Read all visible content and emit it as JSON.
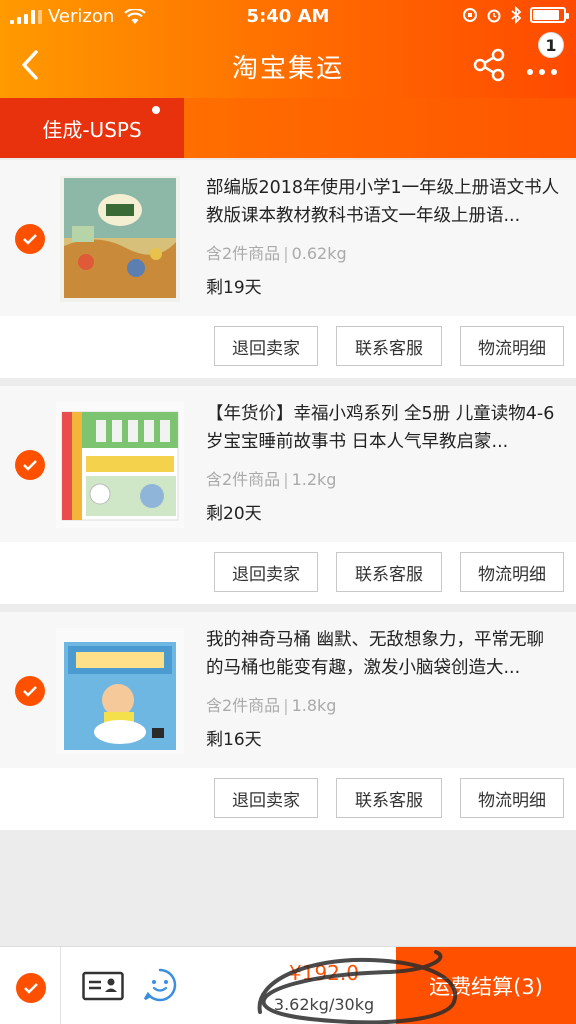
{
  "status_bar": {
    "carrier": "Verizon",
    "time": "5:40 AM",
    "battery_level": 0.85
  },
  "nav": {
    "title": "淘宝集运",
    "more_badge": "1"
  },
  "tabs": [
    {
      "label": "佳成-USPS",
      "active": true,
      "has_dot": true
    }
  ],
  "packages": [
    {
      "title": "部编版2018年使用小学1一年级上册语文书人教版课本教材教科书语文一年级上册语...",
      "item_count": "含2件商品",
      "weight": "0.62kg",
      "days_left": "剩19天",
      "selected": true
    },
    {
      "title": "【年货价】幸福小鸡系列 全5册 儿童读物4-6岁宝宝睡前故事书 日本人气早教启蒙...",
      "item_count": "含2件商品",
      "weight": "1.2kg",
      "days_left": "剩20天",
      "selected": true
    },
    {
      "title": "我的神奇马桶 幽默、无敌想象力，平常无聊的马桶也能变有趣，激发小脑袋创造大...",
      "item_count": "含2件商品",
      "weight": "1.8kg",
      "days_left": "剩16天",
      "selected": true
    }
  ],
  "actions": {
    "return_seller": "退回卖家",
    "contact_service": "联系客服",
    "logistics_detail": "物流明细"
  },
  "bottom_bar": {
    "select_all": true,
    "total_price": "¥192.0",
    "weight_summary": "3.62kg/30kg",
    "checkout_label": "运费结算(3)"
  },
  "colors": {
    "accent": "#ff5000",
    "header_gradient_start": "#ff9a00",
    "tab_active": "#e8320e"
  }
}
